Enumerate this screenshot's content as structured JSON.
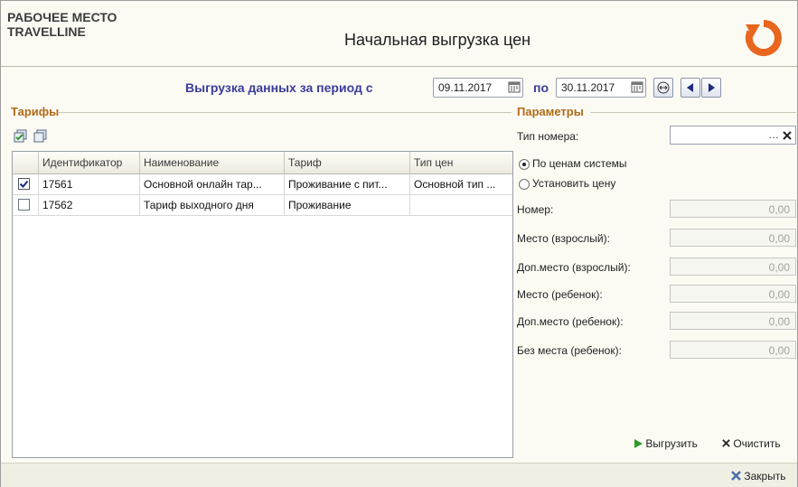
{
  "header": {
    "app_name": "РАБОЧЕЕ МЕСТО\nTRAVELLINE",
    "title": "Начальная выгрузка цен"
  },
  "period": {
    "label": "Выгрузка данных за период с",
    "from_date": "09.11.2017",
    "to_label": "по",
    "to_date": "30.11.2017"
  },
  "tariffs": {
    "group_title": "Тарифы",
    "columns": [
      "Идентификатор",
      "Наименование",
      "Тариф",
      "Тип цен"
    ],
    "rows": [
      {
        "checked": true,
        "id": "17561",
        "name": "Основной онлайн тар...",
        "tariff": "Проживание с пит...",
        "price_type": "Основной тип ..."
      },
      {
        "checked": false,
        "id": "17562",
        "name": "Тариф выходного дня",
        "tariff": "Проживание",
        "price_type": ""
      }
    ]
  },
  "params": {
    "group_title": "Параметры",
    "room_type_label": "Тип номера:",
    "room_type_value": "",
    "radio_system": "По ценам системы",
    "radio_set": "Установить цену",
    "selected_radio": "system",
    "fields": [
      {
        "label": "Номер:",
        "value": "0,00"
      },
      {
        "label": "Место (взрослый):",
        "value": "0,00"
      },
      {
        "label": "Доп.место (взрослый):",
        "value": "0,00"
      },
      {
        "label": "Место (ребенок):",
        "value": "0,00"
      },
      {
        "label": "Доп.место (ребенок):",
        "value": "0,00"
      },
      {
        "label": "Без места (ребенок):",
        "value": "0,00"
      }
    ]
  },
  "actions": {
    "upload": "Выгрузить",
    "clear": "Очистить",
    "close": "Закрыть"
  },
  "colors": {
    "accent_orange": "#e8661e",
    "title_blue": "#3b3c9a",
    "group_orange": "#b16a16",
    "green_arrow": "#2e9a2e"
  }
}
